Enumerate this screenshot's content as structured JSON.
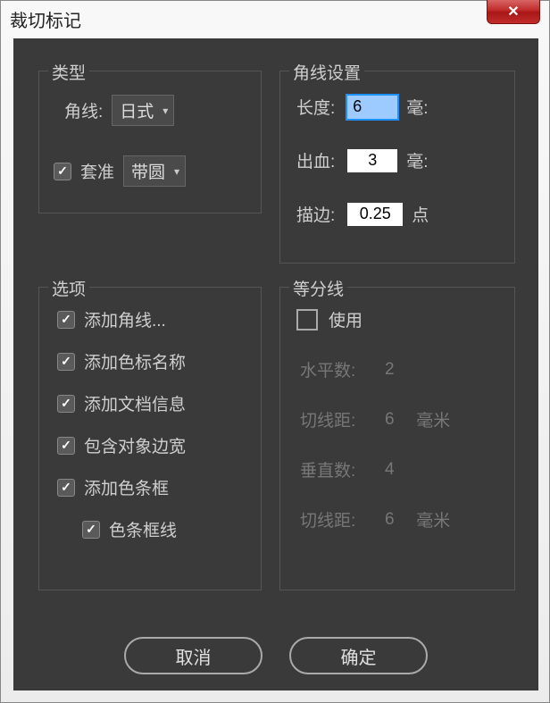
{
  "window": {
    "title": "裁切标记"
  },
  "type_group": {
    "legend": "类型",
    "corner_label": "角线:",
    "corner_value": "日式",
    "register_checked": true,
    "register_label": "套准",
    "register_value": "带圆"
  },
  "corner_settings": {
    "legend": "角线设置",
    "length_label": "长度:",
    "length_value": "6",
    "length_unit": "毫:",
    "bleed_label": "出血:",
    "bleed_value": "3",
    "bleed_unit": "毫:",
    "stroke_label": "描边:",
    "stroke_value": "0.25",
    "stroke_unit": "点"
  },
  "options": {
    "legend": "选项",
    "items": [
      {
        "label": "添加角线...",
        "checked": true,
        "indent": false
      },
      {
        "label": "添加色标名称",
        "checked": true,
        "indent": false
      },
      {
        "label": "添加文档信息",
        "checked": true,
        "indent": false
      },
      {
        "label": "包含对象边宽",
        "checked": true,
        "indent": false
      },
      {
        "label": "添加色条框",
        "checked": true,
        "indent": false
      },
      {
        "label": "色条框线",
        "checked": true,
        "indent": true
      }
    ]
  },
  "dividers": {
    "legend": "等分线",
    "use_label": "使用",
    "use_checked": false,
    "h_count_label": "水平数:",
    "h_count_value": "2",
    "h_dist_label": "切线距:",
    "h_dist_value": "6",
    "h_dist_unit": "毫米",
    "v_count_label": "垂直数:",
    "v_count_value": "4",
    "v_dist_label": "切线距:",
    "v_dist_value": "6",
    "v_dist_unit": "毫米"
  },
  "buttons": {
    "cancel": "取消",
    "ok": "确定"
  }
}
